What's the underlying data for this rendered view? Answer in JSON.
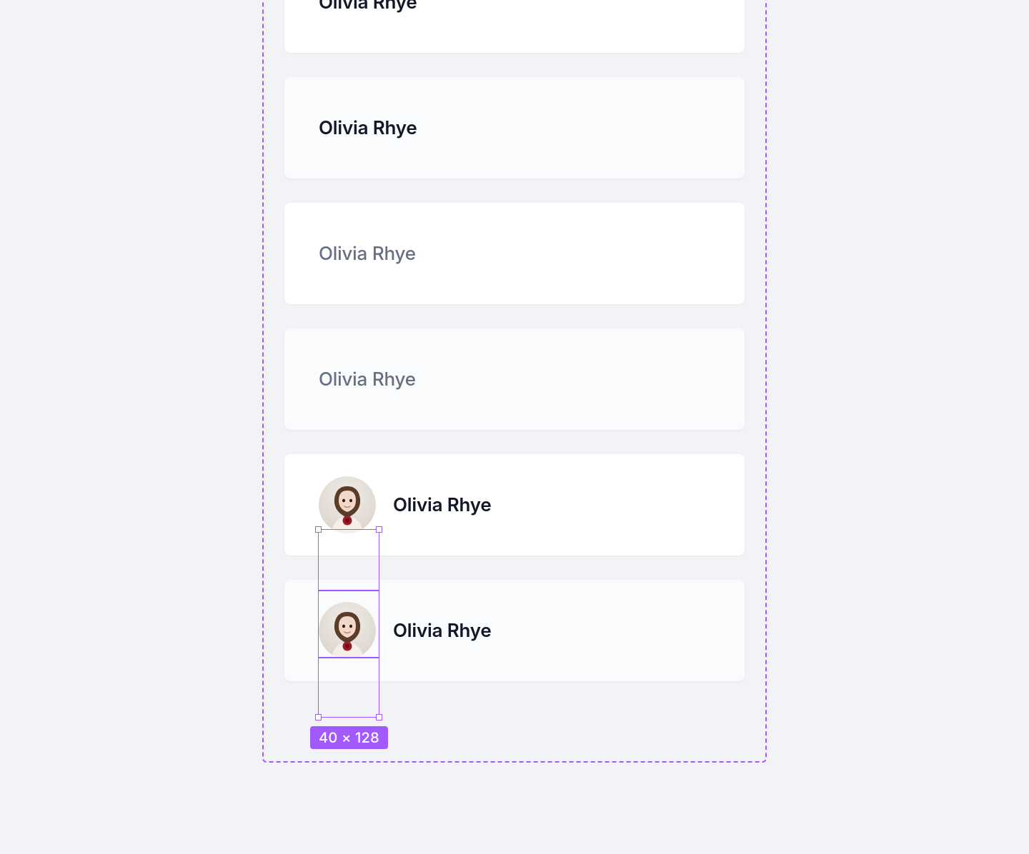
{
  "cards": [
    {
      "label": "Olivia Rhye",
      "variant": "white",
      "tone": "dark",
      "avatar": false
    },
    {
      "label": "Olivia Rhye",
      "variant": "light",
      "tone": "dark",
      "avatar": false
    },
    {
      "label": "Olivia Rhye",
      "variant": "white",
      "tone": "muted",
      "avatar": false
    },
    {
      "label": "Olivia Rhye",
      "variant": "light",
      "tone": "muted",
      "avatar": false
    },
    {
      "label": "Olivia Rhye",
      "variant": "white",
      "tone": "dark",
      "avatar": true
    },
    {
      "label": "Olivia Rhye",
      "variant": "light",
      "tone": "dark",
      "avatar": true
    }
  ],
  "selection": {
    "dimension_label": "40 × 128",
    "selected_avatar_indices": [
      4,
      5
    ]
  },
  "colors": {
    "accent": "#a259ff",
    "bg": "#f2f3f6",
    "card_white": "#ffffff",
    "card_light": "#fafbfc",
    "text_dark": "#101828",
    "text_muted": "#667085"
  }
}
